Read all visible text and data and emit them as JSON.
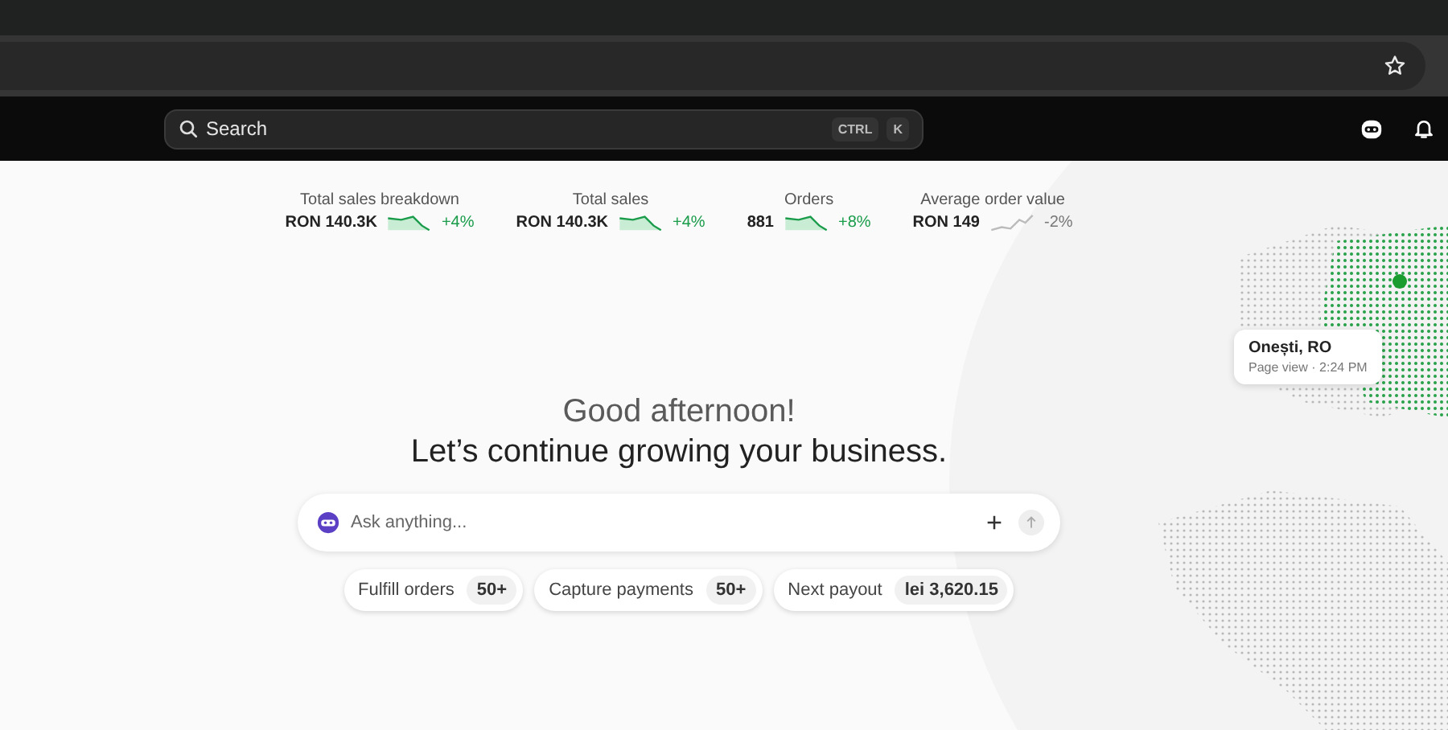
{
  "topbar": {
    "search": {
      "placeholder": "Search"
    },
    "shortcut": [
      "CTRL",
      "K"
    ]
  },
  "metrics": [
    {
      "label": "Total sales breakdown",
      "value": "RON 140.3K",
      "change": "+4%",
      "kind": "up"
    },
    {
      "label": "Total sales",
      "value": "RON 140.3K",
      "change": "+4%",
      "kind": "up"
    },
    {
      "label": "Orders",
      "value": "881",
      "change": "+8%",
      "kind": "up"
    },
    {
      "label": "Average order value",
      "value": "RON 149",
      "change": "-2%",
      "kind": "down"
    }
  ],
  "greeting": {
    "title": "Good afternoon!",
    "subtitle": "Let’s continue growing your business."
  },
  "assistant": {
    "placeholder": "Ask anything..."
  },
  "chips": [
    {
      "label": "Fulfill orders",
      "count": "50+"
    },
    {
      "label": "Capture payments",
      "count": "50+"
    },
    {
      "label": "Next payout",
      "count": "lei 3,620.15"
    }
  ],
  "map_tooltip": {
    "place": "Onești, RO",
    "detail": "Page view · 2:24 PM"
  }
}
